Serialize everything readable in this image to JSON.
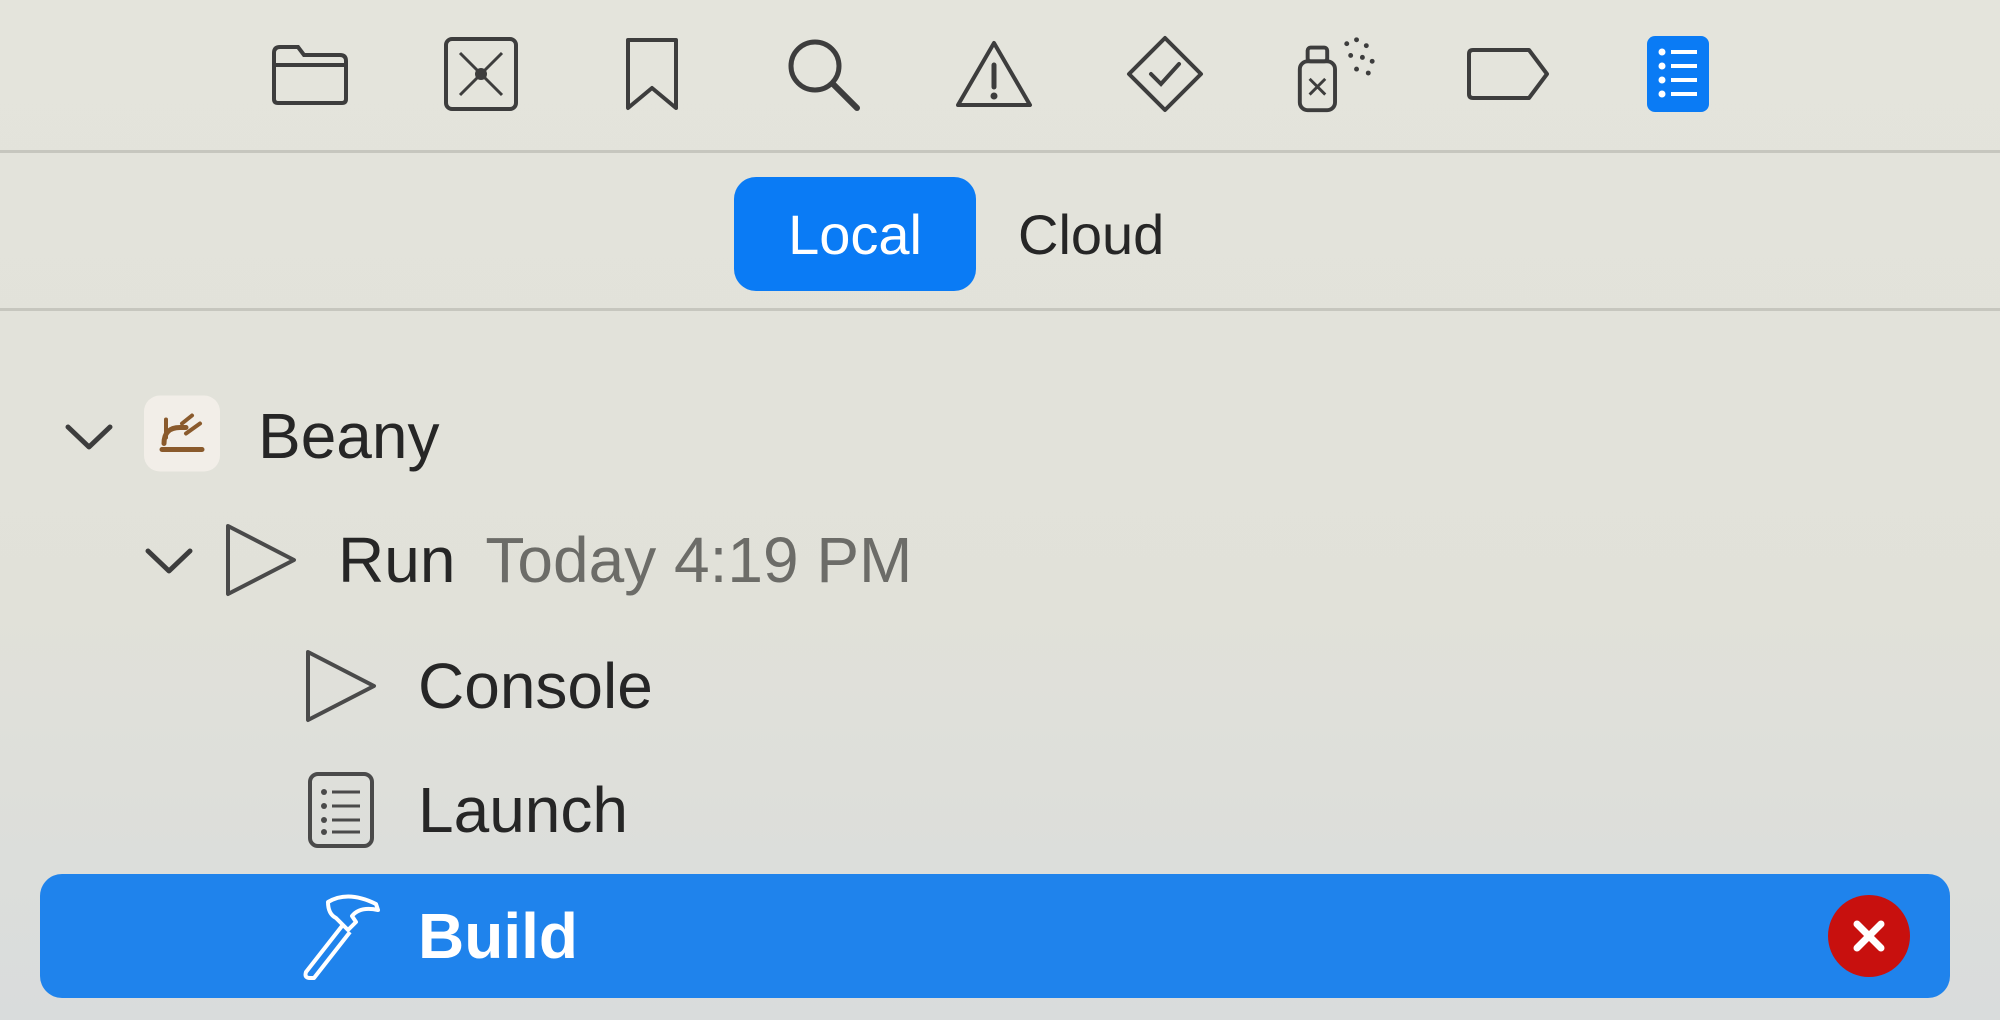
{
  "toolbar": {
    "items": [
      {
        "icon": "folder-icon",
        "label": "Project Navigator"
      },
      {
        "icon": "source-control-icon",
        "label": "Source Control Navigator"
      },
      {
        "icon": "bookmark-icon",
        "label": "Bookmark Navigator"
      },
      {
        "icon": "search-icon",
        "label": "Find Navigator"
      },
      {
        "icon": "warning-icon",
        "label": "Issue Navigator"
      },
      {
        "icon": "test-diamond-icon",
        "label": "Test Navigator"
      },
      {
        "icon": "debug-spray-icon",
        "label": "Debug Navigator"
      },
      {
        "icon": "breakpoint-tag-icon",
        "label": "Breakpoint Navigator"
      },
      {
        "icon": "report-list-icon",
        "label": "Report Navigator",
        "active": true
      }
    ],
    "accent": "#0a7bf5"
  },
  "segmented": {
    "local_label": "Local",
    "cloud_label": "Cloud",
    "selected": "Local"
  },
  "tree": {
    "project": {
      "label": "Beany",
      "expanded": true
    },
    "run": {
      "label": "Run",
      "time": "Today 4:19 PM",
      "expanded": true
    },
    "console": {
      "label": "Console"
    },
    "launch": {
      "label": "Launch"
    },
    "build": {
      "label": "Build",
      "selected": true,
      "status": "error"
    }
  },
  "colors": {
    "selection": "#1f83ec",
    "error": "#c8100e",
    "background": "#e3e3db"
  }
}
